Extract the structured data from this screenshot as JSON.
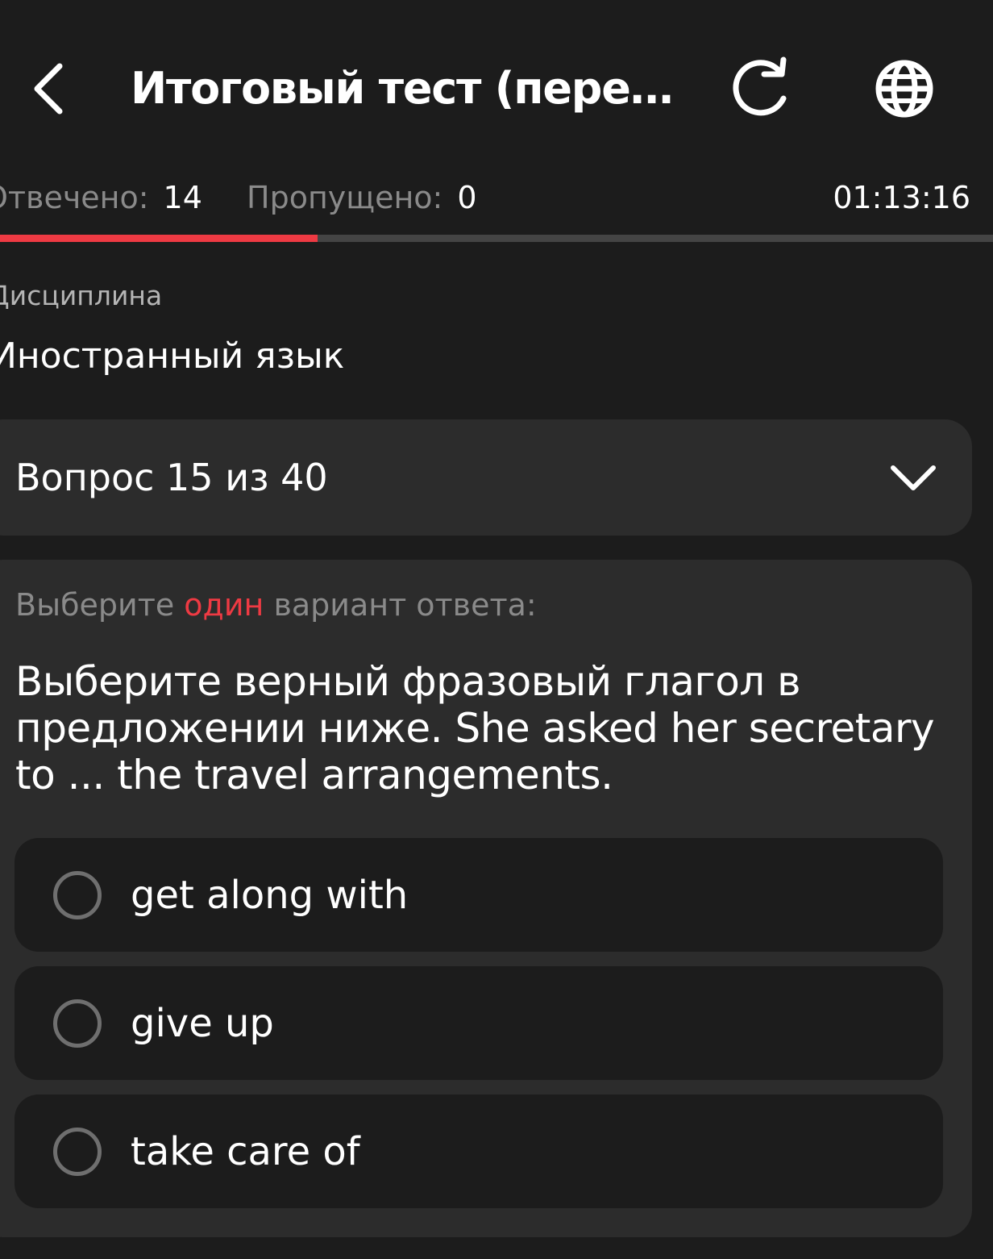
{
  "header": {
    "title": "Итоговый тест (пересдача)",
    "back_icon": "chevron-left-icon",
    "refresh_icon": "refresh-icon",
    "language_icon": "globe-icon"
  },
  "stats": {
    "answered_label": "Отвечено:",
    "answered_value": "14",
    "skipped_label": "Пропущено:",
    "skipped_value": "0",
    "timer": "01:13:16"
  },
  "progress": {
    "fraction": 0.32,
    "fill_color": "#ee3a43",
    "track_color": "#444444"
  },
  "discipline": {
    "label": "Дисциплина",
    "value": "Иностранный язык"
  },
  "question_selector": {
    "label": "Вопрос 15 из 40",
    "icon": "chevron-down-icon"
  },
  "question": {
    "instruction_before": "Выберите ",
    "instruction_accent": "один",
    "instruction_after": " вариант ответа:",
    "text": "Выберите верный фразовый глагол в предложении ниже. She asked her secretary to ... the travel arrangements.",
    "options": [
      {
        "label": "get along with",
        "selected": false
      },
      {
        "label": "give up",
        "selected": false
      },
      {
        "label": "take care of",
        "selected": false
      }
    ]
  },
  "colors": {
    "background": "#1c1c1c",
    "card": "#2c2c2c",
    "accent": "#ee3a43",
    "muted_text": "#8a8a8a"
  }
}
